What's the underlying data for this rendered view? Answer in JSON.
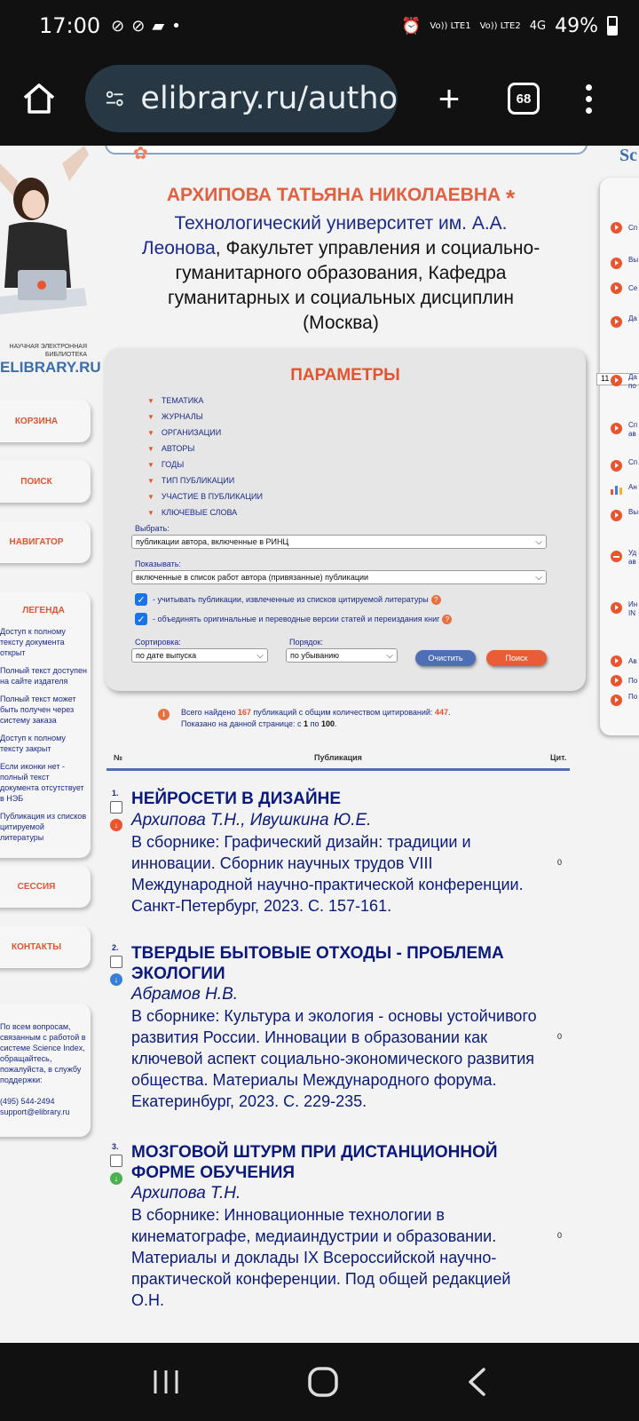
{
  "status": {
    "time": "17:00",
    "net1": "Vo)) LTE1",
    "net2": "Vo)) LTE2",
    "net_type": "4G",
    "battery": "49%"
  },
  "browser": {
    "url": "elibrary.ru/autho",
    "tab_count": "68"
  },
  "sidebar": {
    "logo_small": "НАУЧНАЯ ЭЛЕКТРОННАЯ БИБЛИОТЕКА",
    "logo_big": "ELIBRARY.RU",
    "cart": "КОРЗИНА",
    "search": "ПОИСК",
    "navigator": "НАВИГАТОР",
    "legend_title": "ЛЕГЕНДА",
    "legend_items": [
      "Доступ к полному тексту документа открыт",
      "Полный текст доступен на сайте издателя",
      "Полный текст может быть получен через систему заказа",
      "Доступ к полному тексту закрыт",
      "Если иконки нет - полный текст документа отсутствует в НЭБ",
      "Публикация из списков цитируемой литературы"
    ],
    "session": "СЕССИЯ",
    "contacts": "КОНТАКТЫ",
    "support_text": "По всем вопросам, связанным с работой в системе Science Index, обращайтесь, пожалуйста, в службу поддержки:",
    "support_phone": "(495) 544-2494",
    "support_email": "support@elibrary.ru"
  },
  "author": {
    "name": "АРХИПОВА ТАТЬЯНА НИКОЛАЕВНА",
    "star": "*",
    "university": "Технологический университет им. А.А. Леонова",
    "affiliation_rest": ", Факультет управления и социально-гуманитарного образования, Кафедра гуманитарных и социальных дисциплин (Москва)"
  },
  "params": {
    "title": "ПАРАМЕТРЫ",
    "filters": [
      "ТЕМАТИКА",
      "ЖУРНАЛЫ",
      "ОРГАНИЗАЦИИ",
      "АВТОРЫ",
      "ГОДЫ",
      "ТИП ПУБЛИКАЦИИ",
      "УЧАСТИЕ В ПУБЛИКАЦИИ",
      "КЛЮЧЕВЫЕ СЛОВА"
    ],
    "choose_label": "Выбрать:",
    "choose_value": "публикации автора, включенные в РИНЦ",
    "show_label": "Показывать:",
    "show_value": "включенные в список работ автора (привязанные) публикации",
    "check1": "- учитывать публикации, извлеченные из списков цитируемой литературы",
    "check2": "- объединять оригинальные и переводные версии статей и переиздания книг",
    "sort_label": "Сортировка:",
    "sort_value": "по дате выпуска",
    "order_label": "Порядок:",
    "order_value": "по убыванию",
    "clear_btn": "Очистить",
    "search_btn": "Поиск"
  },
  "summary": {
    "prefix": "Всего найдено",
    "found": "167",
    "middle": "публикаций с общим количеством цитирований:",
    "citations": "447",
    "shown_prefix": "Показано на данной странице: с",
    "shown_from": "1",
    "shown_mid": "по",
    "shown_to": "100"
  },
  "table": {
    "col_num": "№",
    "col_pub": "Публикация",
    "col_cit": "Цит."
  },
  "publications": [
    {
      "num": "1.",
      "title": "НЕЙРОСЕТИ В ДИЗАЙНЕ",
      "authors": "Архипова Т.Н., Ивушкина Ю.Е.",
      "source": "В сборнике: Графический дизайн: традиции и инновации. Сборник научных трудов VIII Международной научно-практической конференции. Санкт-Петербург, 2023. С. 157-161.",
      "cit": "0"
    },
    {
      "num": "2.",
      "title": "ТВЕРДЫЕ БЫТОВЫЕ ОТХОДЫ - ПРОБЛЕМА ЭКОЛОГИИ",
      "authors": "Абрамов Н.В.",
      "source": "В сборнике: Культура и экология - основы устойчивого развития России. Инновации в образовании как ключевой аспект социально-экономического развития общества. Материалы Международного форума. Екатеринбург, 2023. С. 229-235.",
      "cit": "0"
    },
    {
      "num": "3.",
      "title": "МОЗГОВОЙ ШТУРМ ПРИ ДИСТАНЦИОННОЙ ФОРМЕ ОБУЧЕНИЯ",
      "authors": "Архипова Т.Н.",
      "source": "В сборнике: Инновационные технологии в кинематографе, медиаиндустрии и образовании. Материалы и доклады IX Всероссийской научно-практической конференции. Под общей редакцией О.Н.",
      "cit": "0"
    }
  ],
  "right_sidebar": {
    "head": "Sc",
    "input_value": "11",
    "items": [
      "Сп",
      "Вы эт",
      "Се",
      "Да пу",
      "Да ав по",
      "Сп со ав",
      "Сп ав",
      "Ан ак",
      "Вы пу",
      "Уд пу ав",
      "Ин ав IN",
      "Ав",
      "По",
      "По ли"
    ]
  },
  "colors": {
    "accent": "#e0552f",
    "link": "#1a2a88",
    "button_blue": "#4f6fb5"
  }
}
